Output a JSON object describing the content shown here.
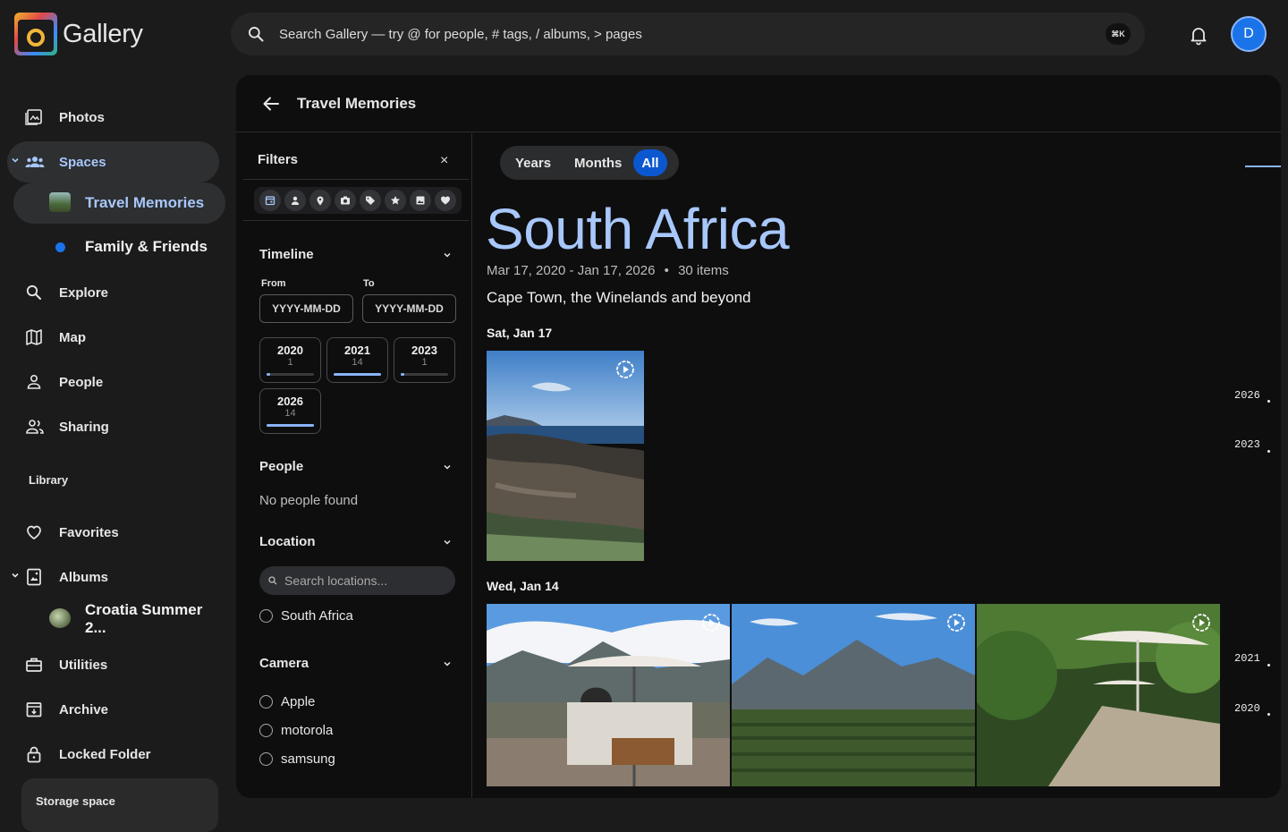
{
  "app": {
    "name": "Gallery",
    "avatar_letter": "D"
  },
  "search": {
    "placeholder": "Search Gallery — try @ for people, # tags, / albums, > pages",
    "shortcut": "⌘K"
  },
  "sidebar": {
    "photos": "Photos",
    "spaces": "Spaces",
    "travel_memories": "Travel Memories",
    "family_friends": "Family & Friends",
    "explore": "Explore",
    "map": "Map",
    "people": "People",
    "sharing": "Sharing",
    "library_label": "Library",
    "favorites": "Favorites",
    "albums": "Albums",
    "croatia": "Croatia Summer 2...",
    "utilities": "Utilities",
    "archive": "Archive",
    "locked_folder": "Locked Folder",
    "storage": "Storage space"
  },
  "page": {
    "title": "Travel Memories"
  },
  "filters": {
    "heading": "Filters",
    "close": "×",
    "timeline": {
      "title": "Timeline",
      "from_label": "From",
      "to_label": "To",
      "from_placeholder": "YYYY-MM-DD",
      "to_placeholder": "YYYY-MM-DD",
      "years": [
        {
          "year": "2020",
          "count": "1",
          "fill": 0.07
        },
        {
          "year": "2021",
          "count": "14",
          "fill": 1.0
        },
        {
          "year": "2023",
          "count": "1",
          "fill": 0.07
        },
        {
          "year": "2026",
          "count": "14",
          "fill": 1.0
        }
      ]
    },
    "people": {
      "title": "People",
      "empty": "No people found"
    },
    "location": {
      "title": "Location",
      "placeholder": "Search locations...",
      "options": [
        "South Africa"
      ]
    },
    "camera": {
      "title": "Camera",
      "options": [
        "Apple",
        "motorola",
        "samsung"
      ]
    }
  },
  "view": {
    "segments": [
      "Years",
      "Months",
      "All"
    ],
    "selected": "All"
  },
  "album": {
    "place": "South Africa",
    "date_range": "Mar 17, 2020 - Jan 17, 2026",
    "separator": "•",
    "item_count": "30 items",
    "subtitle": "Cape Town, the Winelands and beyond"
  },
  "groups": [
    {
      "day": "Sat, Jan 17"
    },
    {
      "day": "Wed, Jan 14"
    }
  ],
  "scrubber": {
    "years": [
      "2026",
      "2023",
      "2021",
      "2020"
    ]
  },
  "colors": {
    "accent": "#8ab4f8",
    "brand_blue": "#0b57d0",
    "title_blue": "#a8c7fa"
  }
}
